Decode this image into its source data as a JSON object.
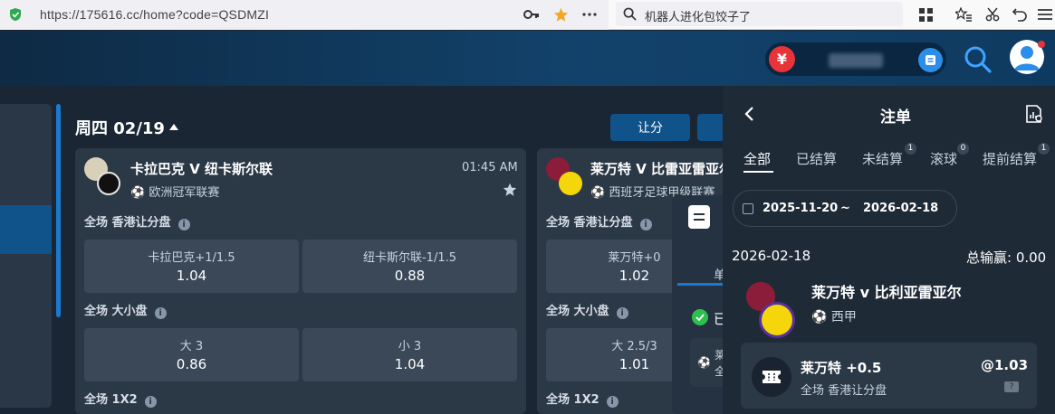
{
  "browser": {
    "url": "https://175616.cc/home?code=QSDMZI",
    "search_text": "机器人进化包饺子了"
  },
  "header": {
    "currency_symbol": "¥"
  },
  "schedule": {
    "day_title": "周四 02/19",
    "tabs": [
      "让分",
      ""
    ]
  },
  "matches": [
    {
      "title": "卡拉巴克 V 纽卡斯尔联",
      "league": "欧洲冠军联赛",
      "time": "01:45 AM",
      "markets": [
        {
          "label": "全场 香港让分盘",
          "odds": [
            {
              "name": "卡拉巴克+1/1.5",
              "value": "1.04"
            },
            {
              "name": "纽卡斯尔联-1/1.5",
              "value": "0.88"
            }
          ]
        },
        {
          "label": "全场 大小盘",
          "odds": [
            {
              "name": "大 3",
              "value": "0.86"
            },
            {
              "name": "小 3",
              "value": "1.04"
            }
          ]
        },
        {
          "label": "全场 1X2",
          "odds": []
        }
      ]
    },
    {
      "title": "莱万特 V 比雷亚雷亚尔",
      "league": "西班牙足球甲级联赛",
      "markets": [
        {
          "label": "全场 香港让分盘",
          "odds": [
            {
              "name": "莱万特+0",
              "value": "1.02"
            }
          ]
        },
        {
          "label": "全场 大小盘",
          "odds": [
            {
              "name": "大 2.5/3",
              "value": "1.01"
            }
          ]
        },
        {
          "label": "全场 1X2",
          "odds": []
        }
      ]
    }
  ],
  "slip_tab": {
    "label_partial": "单",
    "status_partial": "已",
    "row_partial_1": "莱",
    "row_partial_2": "全"
  },
  "panel": {
    "title": "注单",
    "tabs": [
      {
        "label": "全部",
        "count": ""
      },
      {
        "label": "已结算",
        "count": ""
      },
      {
        "label": "未结算",
        "count": "1"
      },
      {
        "label": "滚球",
        "count": "0"
      },
      {
        "label": "提前结算",
        "count": "1"
      }
    ],
    "date_from": "2025-11-20",
    "date_sep": "~",
    "date_to": "2026-02-18",
    "bet_date": "2026-02-18",
    "total_label": "总输赢: 0.00",
    "bet": {
      "match": "莱万特 v 比利亚雷亚尔",
      "league": "西甲",
      "selection": "莱万特 +0.5",
      "market": "全场 香港让分盘",
      "odds": "@1.03",
      "badge": "?"
    }
  },
  "colors": {
    "accent_blue": "#10528a",
    "currency_red": "#e8333a",
    "panel_bg": "#1f2a37",
    "card_bg": "#2b3846"
  }
}
